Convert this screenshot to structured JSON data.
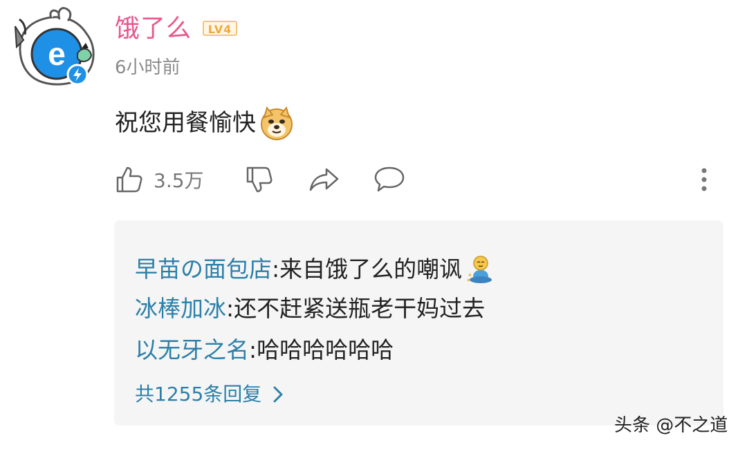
{
  "comment": {
    "username": "饿了么",
    "level_badge": "LV4",
    "timestamp": "6小时前",
    "text": "祝您用餐愉快",
    "emoji": "doge-emoji"
  },
  "actions": {
    "like_count": "3.5万",
    "icons": [
      "thumbs-up-icon",
      "thumbs-down-icon",
      "share-icon",
      "comment-icon",
      "more-vertical-icon"
    ]
  },
  "replies": [
    {
      "author": "早苗の面包店",
      "separator": ": ",
      "text": "来自饿了么的嘲讽",
      "emoji": "meditating-person-emoji"
    },
    {
      "author": "冰棒加冰",
      "separator": ": ",
      "text": "还不赶紧送瓶老干妈过去"
    },
    {
      "author": "以无牙之名",
      "separator": ": ",
      "text": "哈哈哈哈哈哈"
    }
  ],
  "more_replies_label": "共1255条回复",
  "watermark": "头条 @不之道",
  "colors": {
    "username": "#e8578c",
    "reply_author": "#2b7fa8",
    "reply_box_bg": "#f5f5f5",
    "muted": "#8a8a8a"
  }
}
